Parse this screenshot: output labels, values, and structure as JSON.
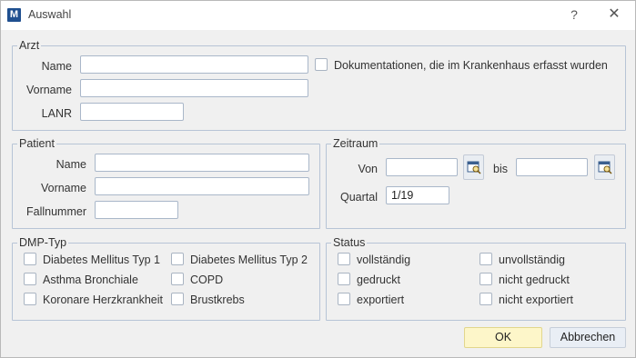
{
  "window": {
    "title": "Auswahl",
    "help_label": "?",
    "close_label": "✕",
    "app_icon_letter": "M"
  },
  "arzt": {
    "legend": "Arzt",
    "name_label": "Name",
    "name_value": "",
    "vorname_label": "Vorname",
    "vorname_value": "",
    "lanr_label": "LANR",
    "lanr_value": "",
    "krankenhaus_label": "Dokumentationen, die im Krankenhaus erfasst wurden"
  },
  "patient": {
    "legend": "Patient",
    "name_label": "Name",
    "name_value": "",
    "vorname_label": "Vorname",
    "vorname_value": "",
    "fallnummer_label": "Fallnummer",
    "fallnummer_value": ""
  },
  "zeitraum": {
    "legend": "Zeitraum",
    "von_label": "Von",
    "von_value": "",
    "bis_label": "bis",
    "bis_value": "",
    "quartal_label": "Quartal",
    "quartal_value": "1/19"
  },
  "dmp": {
    "legend": "DMP-Typ",
    "items": [
      "Diabetes Mellitus Typ 1",
      "Diabetes Mellitus Typ 2",
      "Asthma Bronchiale",
      "COPD",
      "Koronare Herzkrankheit",
      "Brustkrebs"
    ]
  },
  "status": {
    "legend": "Status",
    "items": [
      "vollständig",
      "unvollständig",
      "gedruckt",
      "nicht gedruckt",
      "exportiert",
      "nicht exportiert"
    ]
  },
  "buttons": {
    "ok": "OK",
    "cancel": "Abbrechen"
  }
}
